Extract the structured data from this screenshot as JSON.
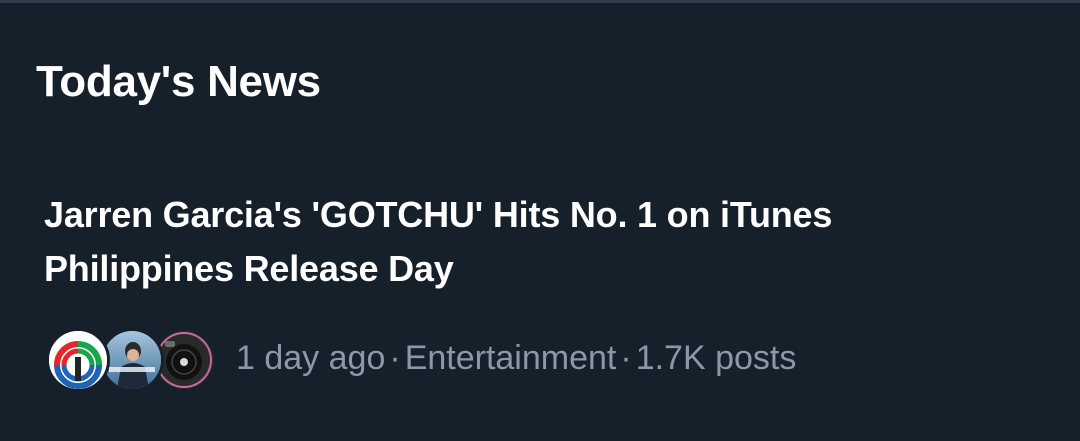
{
  "section": {
    "title": "Today's News"
  },
  "news": [
    {
      "headline": "Jarren Garcia's 'GOTCHU' Hits No. 1 on iTunes Philippines Release Day",
      "time": "1 day ago",
      "category": "Entertainment",
      "posts": "1.7K posts",
      "separator": "·",
      "avatars": [
        "abs-cbn-logo-avatar",
        "jarren-garcia-album-avatar",
        "vinyl-record-avatar"
      ]
    }
  ],
  "colors": {
    "background": "#15202b",
    "text_primary": "#ffffff",
    "text_secondary": "#8b98a5",
    "divider": "#2f3b47"
  }
}
